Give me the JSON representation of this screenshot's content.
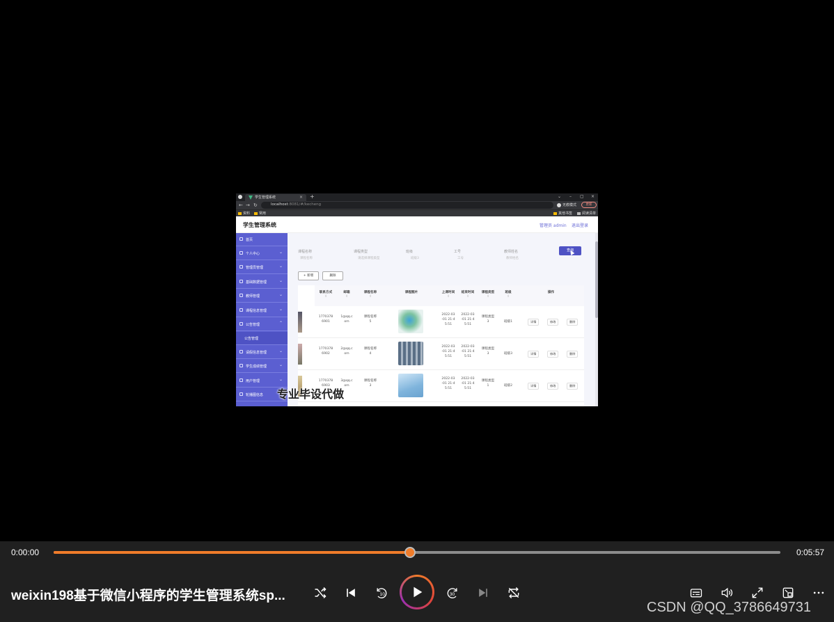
{
  "browser": {
    "tab_title": "学生管理系统",
    "url_host": "localhost",
    "url_path": ":8081/#/kecheng",
    "profile_label": "无痕模式",
    "update_label": "更新",
    "bookmarks": [
      "资料",
      "常用"
    ],
    "bookmarks_right": [
      "其他书签",
      "阅读清单"
    ]
  },
  "app": {
    "title": "学生管理系统",
    "user": "管理员 admin",
    "logout": "退出登录",
    "sidebar": [
      {
        "label": "首页",
        "expanded": false
      },
      {
        "label": "个人中心",
        "expanded": false
      },
      {
        "label": "管理员管理",
        "expanded": false
      },
      {
        "label": "基础数据管理",
        "expanded": false
      },
      {
        "label": "教师管理",
        "expanded": false
      },
      {
        "label": "课程信息管理",
        "expanded": false
      },
      {
        "label": "公告管理",
        "expanded": true
      },
      {
        "label": "公告管理",
        "expanded": false
      },
      {
        "label": "请假信息管理",
        "expanded": false
      },
      {
        "label": "学生成绩管理",
        "expanded": false
      },
      {
        "label": "用户管理",
        "expanded": false
      },
      {
        "label": "轮播图信息",
        "expanded": false
      }
    ],
    "filters": [
      {
        "label": "课程名称",
        "placeholder": "课程名称"
      },
      {
        "label": "课程类型",
        "placeholder": "请选择课程类型"
      },
      {
        "label": "班级",
        "placeholder": "班级3"
      },
      {
        "label": "工号",
        "placeholder": "工号"
      },
      {
        "label": "教师姓名",
        "placeholder": "教师姓名"
      }
    ],
    "search_label": "查询",
    "add_label": "+ 新增",
    "delete_label": "删除",
    "table": {
      "headers": [
        "联系方式",
        "邮箱",
        "课程名称",
        "课程图片",
        "上课时间",
        "结束时间",
        "课程类型",
        "班级",
        "操作"
      ],
      "rows": [
        {
          "phone": "1770378\n6901",
          "email": "1@qq.c\nom",
          "name": "课程名称\n5",
          "start": "2022-03\n-01 21:4\n5:51",
          "end": "2022-03\n-01 21:4\n5:51",
          "type": "课程类型\n3",
          "class": "班级1"
        },
        {
          "phone": "1770378\n6902",
          "email": "2@qq.c\nom",
          "name": "课程名称\n4",
          "start": "2022-03\n-01 21:4\n5:51",
          "end": "2022-03\n-01 21:4\n5:51",
          "type": "课程类型\n3",
          "class": "班级3"
        },
        {
          "phone": "1770378\n6903",
          "email": "3@qq.c\nom",
          "name": "课程名称\n3",
          "start": "2022-03\n-01 21:4\n5:51",
          "end": "2022-03\n-01 21:4\n5:51",
          "type": "课程类型\n1",
          "class": "班级2"
        }
      ],
      "ops": [
        "详情",
        "修改",
        "删除"
      ]
    },
    "watermark": "专业毕设代做"
  },
  "player": {
    "current_time": "0:00:00",
    "total_time": "0:05:57",
    "progress": 0.49,
    "title": "weixin198基于微信小程序的学生管理系统sp...",
    "skip_back": "10",
    "skip_forward": "30",
    "accent_color": "#f07c2a"
  },
  "brand": "CSDN @QQ_3786649731"
}
